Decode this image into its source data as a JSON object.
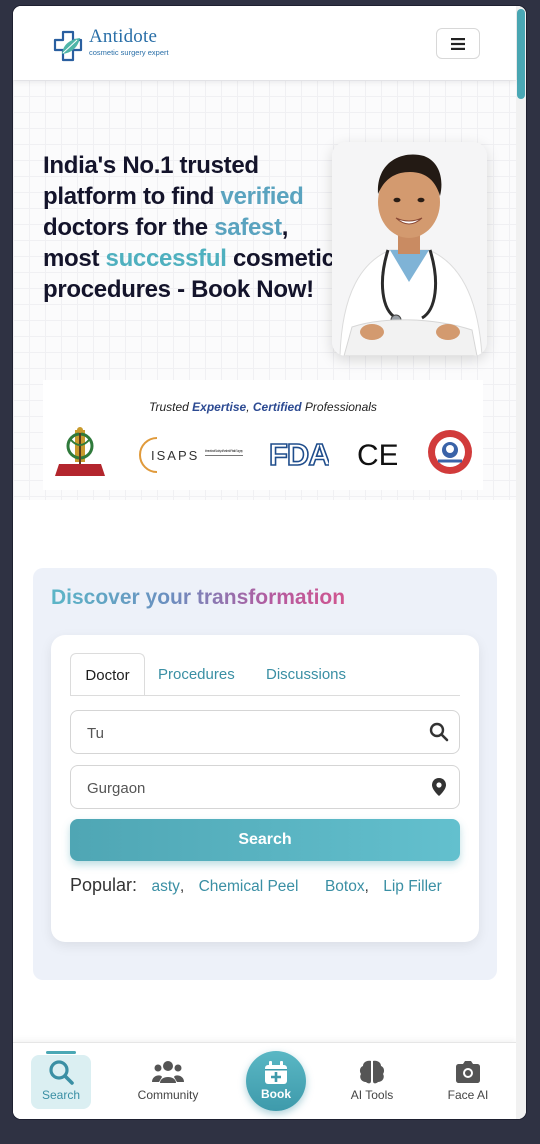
{
  "header": {
    "logo_title": "Antidote",
    "logo_subtitle": "cosmetic surgery expert",
    "menu_icon": "hamburger-icon"
  },
  "hero": {
    "headline": {
      "p1": "India's No.1 trusted platform to find ",
      "verified": "verified",
      "p2": " doctors for the ",
      "safest": "safest",
      "p3": ", most ",
      "successful": "successful",
      "p4": " cosmetic procedures - Book Now!"
    }
  },
  "trust": {
    "c1": "Trusted ",
    "c2": "Expertise",
    "c3": ", ",
    "c4": "Certified",
    "c5": " Professionals",
    "badges": {
      "isaps": "ISAPS",
      "isaps_small": "International Society of Aesthetic Plastic Surgery",
      "fda": "FDA",
      "ce": "CE"
    }
  },
  "discover": {
    "title": "Discover your transformation",
    "tabs": [
      "Doctor",
      "Procedures",
      "Discussions"
    ],
    "query_value": "Tu",
    "location_value": "Gurgaon",
    "search_label": "Search",
    "popular_label": "Popular:",
    "popular_items": [
      "asty",
      "Chemical Peel",
      "Botox",
      "Lip Filler"
    ]
  },
  "bottom_nav": {
    "items": [
      {
        "label": "Search",
        "icon": "search-icon"
      },
      {
        "label": "Community",
        "icon": "people-icon"
      },
      {
        "label": "Book",
        "icon": "calendar-plus-icon"
      },
      {
        "label": "AI Tools",
        "icon": "brain-icon"
      },
      {
        "label": "Face AI",
        "icon": "camera-icon"
      }
    ]
  },
  "colors": {
    "accent": "#4aa8b5",
    "highlight_blue": "#5aa3bf",
    "highlight_pink": "#c04a86",
    "background": "#2f3243"
  }
}
